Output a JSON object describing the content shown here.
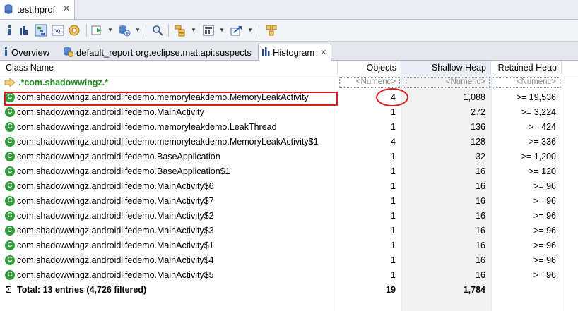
{
  "editor": {
    "tab_title": "test.hprof"
  },
  "view_tabs": [
    {
      "label": "Overview"
    },
    {
      "label": "default_report  org.eclipse.mat.api:suspects"
    },
    {
      "label": "Histogram"
    }
  ],
  "columns": {
    "class_name": "Class Name",
    "objects": "Objects",
    "shallow": "Shallow Heap",
    "retained": "Retained Heap"
  },
  "filter": {
    "regex": ".*com.shadowwingz.*",
    "objects": "<Numeric>",
    "shallow": "<Numeric>",
    "retained": "<Numeric>"
  },
  "rows": [
    {
      "name": "com.shadowwingz.androidlifedemo.memoryleakdemo.MemoryLeakActivity",
      "objects": "4",
      "shallow": "1,088",
      "retained": ">= 19,536"
    },
    {
      "name": "com.shadowwingz.androidlifedemo.MainActivity",
      "objects": "1",
      "shallow": "272",
      "retained": ">= 3,224"
    },
    {
      "name": "com.shadowwingz.androidlifedemo.memoryleakdemo.LeakThread",
      "objects": "1",
      "shallow": "136",
      "retained": ">= 424"
    },
    {
      "name": "com.shadowwingz.androidlifedemo.memoryleakdemo.MemoryLeakActivity$1",
      "objects": "4",
      "shallow": "128",
      "retained": ">= 336"
    },
    {
      "name": "com.shadowwingz.androidlifedemo.BaseApplication",
      "objects": "1",
      "shallow": "32",
      "retained": ">= 1,200"
    },
    {
      "name": "com.shadowwingz.androidlifedemo.BaseApplication$1",
      "objects": "1",
      "shallow": "16",
      "retained": ">= 120"
    },
    {
      "name": "com.shadowwingz.androidlifedemo.MainActivity$6",
      "objects": "1",
      "shallow": "16",
      "retained": ">= 96"
    },
    {
      "name": "com.shadowwingz.androidlifedemo.MainActivity$7",
      "objects": "1",
      "shallow": "16",
      "retained": ">= 96"
    },
    {
      "name": "com.shadowwingz.androidlifedemo.MainActivity$2",
      "objects": "1",
      "shallow": "16",
      "retained": ">= 96"
    },
    {
      "name": "com.shadowwingz.androidlifedemo.MainActivity$3",
      "objects": "1",
      "shallow": "16",
      "retained": ">= 96"
    },
    {
      "name": "com.shadowwingz.androidlifedemo.MainActivity$1",
      "objects": "1",
      "shallow": "16",
      "retained": ">= 96"
    },
    {
      "name": "com.shadowwingz.androidlifedemo.MainActivity$4",
      "objects": "1",
      "shallow": "16",
      "retained": ">= 96"
    },
    {
      "name": "com.shadowwingz.androidlifedemo.MainActivity$5",
      "objects": "1",
      "shallow": "16",
      "retained": ">= 96"
    }
  ],
  "total": {
    "label": "Total: 13 entries (4,726 filtered)",
    "objects": "19",
    "shallow": "1,784"
  },
  "icons": {
    "class": "class-c-icon",
    "total": "sigma-icon",
    "filter": "filter-arrow-icon"
  },
  "colors": {
    "class_icon": "#2f9e3a",
    "highlight": "#e01b1b",
    "filter_text": "#1f8d1f"
  }
}
